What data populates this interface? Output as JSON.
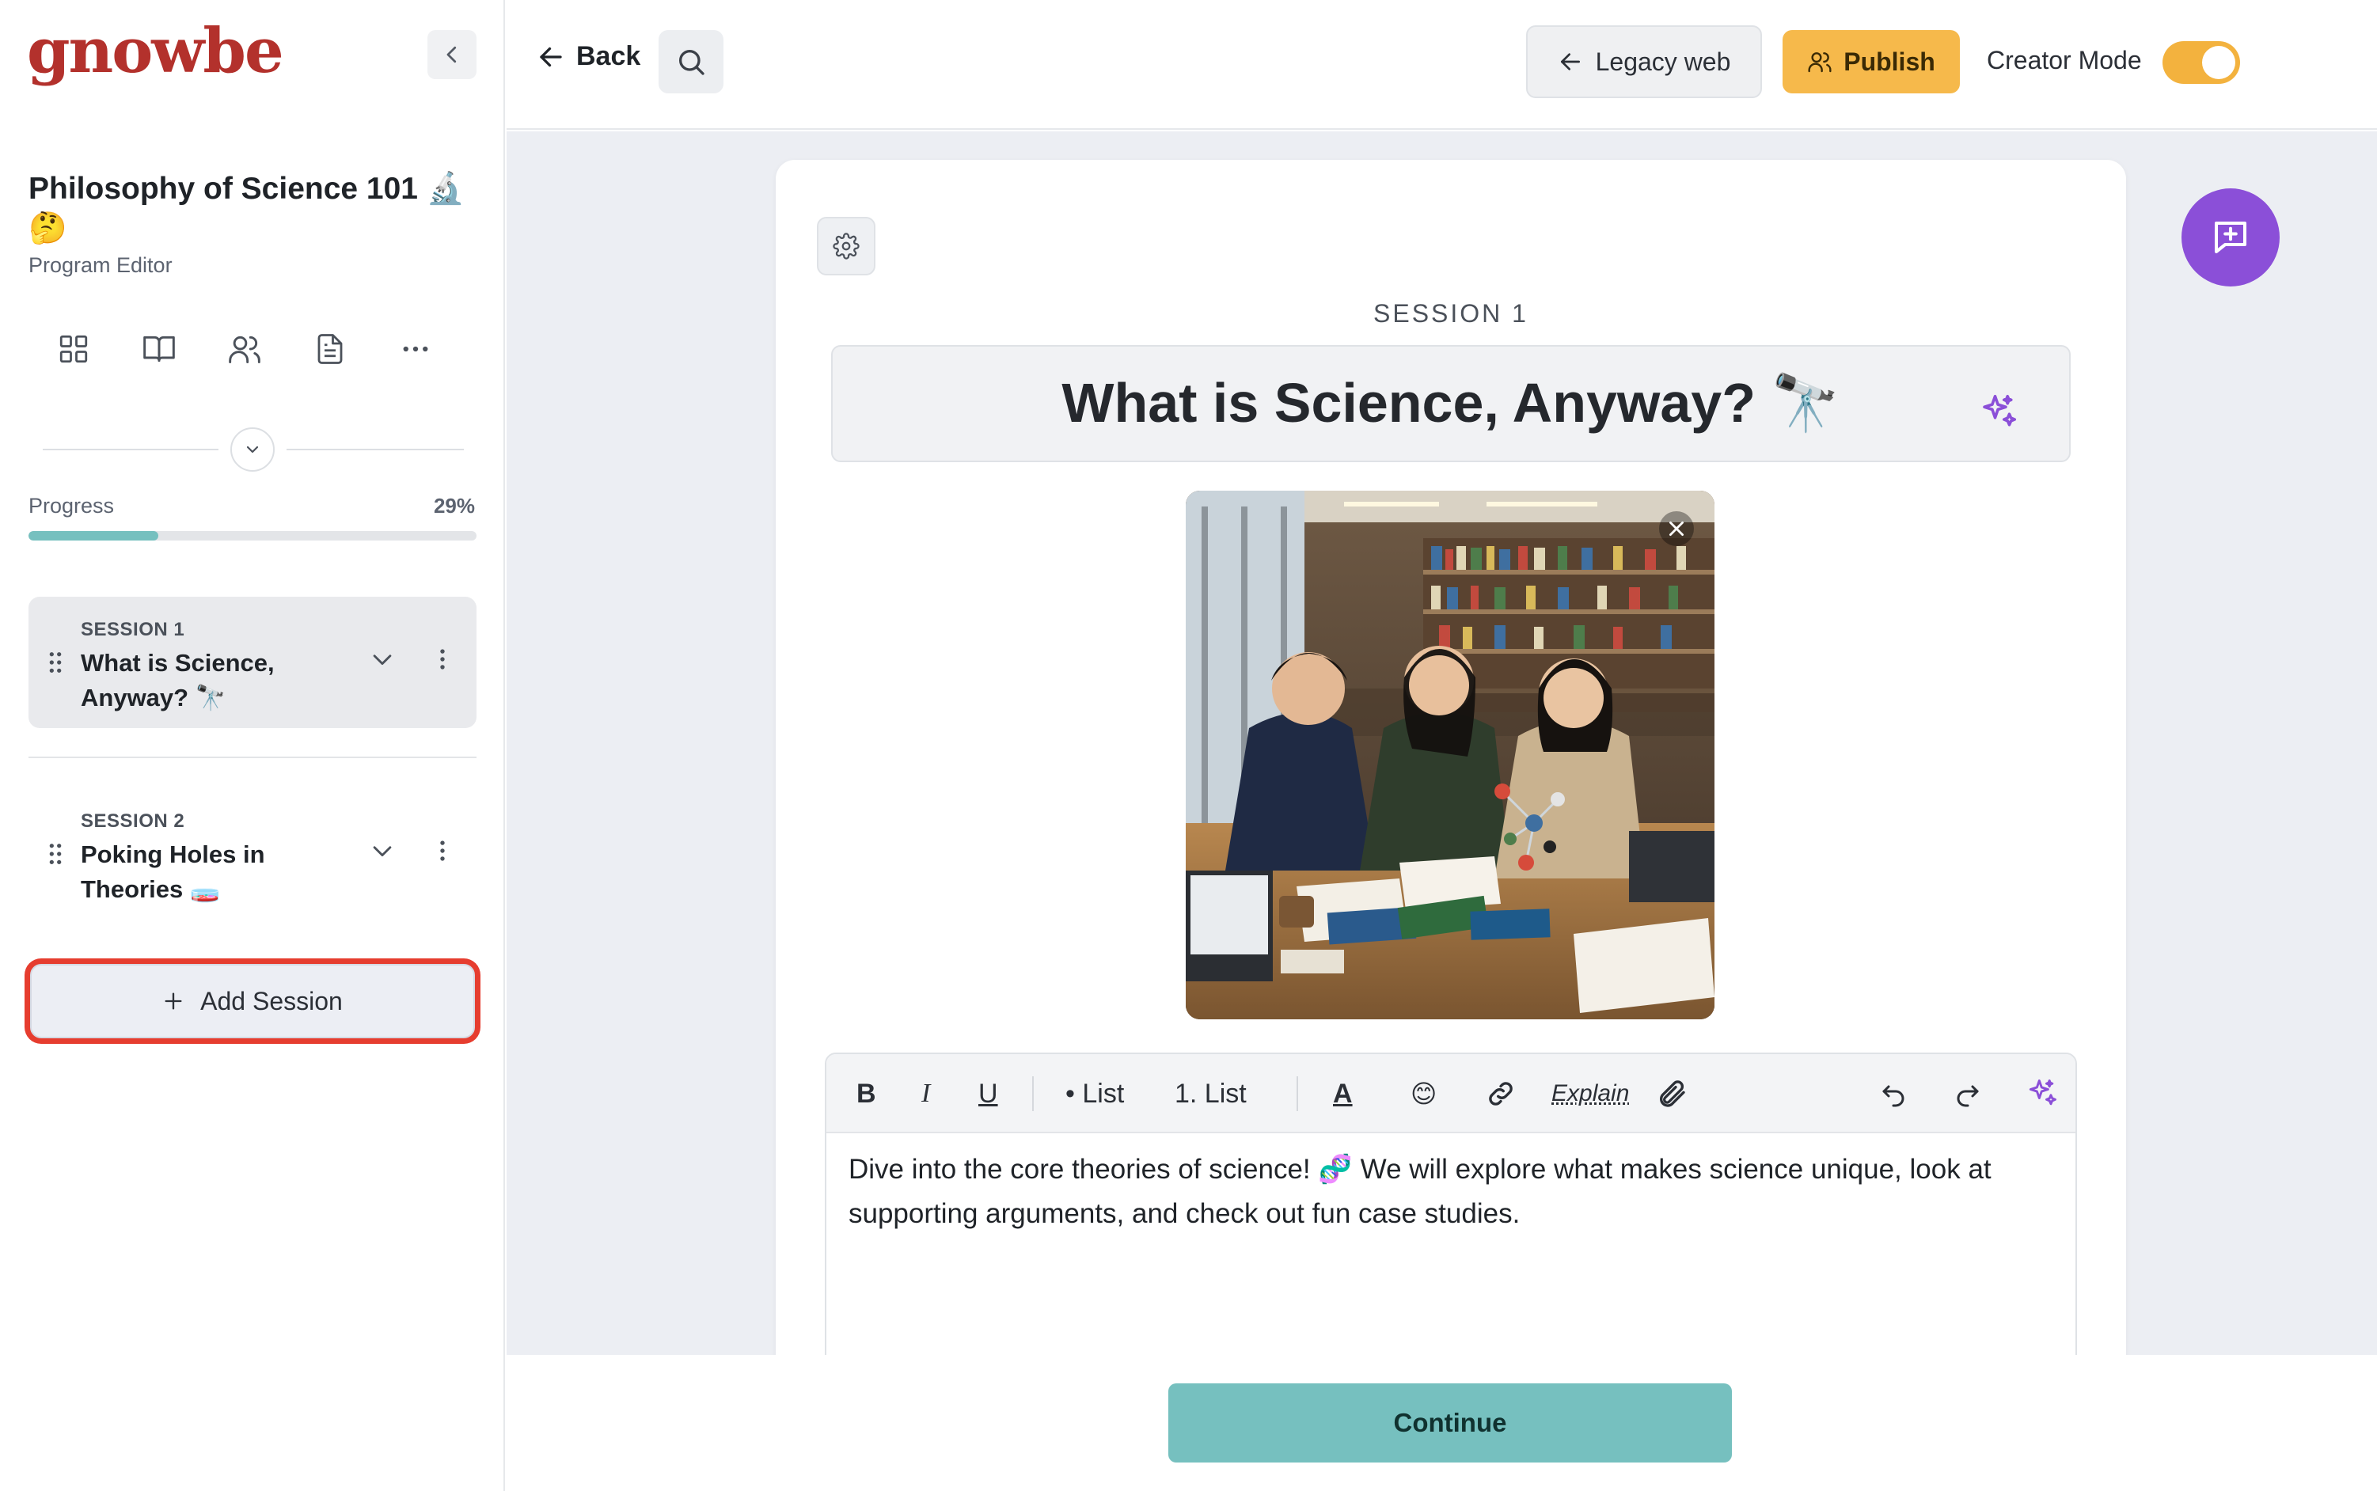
{
  "brand": {
    "logo_text": "gnowbe",
    "logo_color": "#b3312c"
  },
  "sidebar": {
    "program_title": "Philosophy of Science 101 🔬🤔",
    "program_subtitle": "Program Editor",
    "nav_icons": [
      "grid-icon",
      "book-icon",
      "users-icon",
      "document-icon",
      "more-icon"
    ],
    "progress": {
      "label": "Progress",
      "percent_text": "29%",
      "value": 0.29
    },
    "sessions": [
      {
        "label": "SESSION 1",
        "title": "What is Science, Anyway? 🔭",
        "active": true
      },
      {
        "label": "SESSION 2",
        "title": "Poking Holes in Theories 🧫",
        "active": false
      }
    ],
    "add_session_label": "Add Session"
  },
  "topbar": {
    "back_label": "Back",
    "legacy_label": "Legacy web",
    "publish_label": "Publish",
    "creator_mode_label": "Creator Mode",
    "creator_mode_on": true
  },
  "editor": {
    "session_tag": "SESSION 1",
    "session_title": "What is Science, Anyway? 🔭",
    "toolbar": {
      "bold": "B",
      "italic": "I",
      "underline": "U",
      "bullet_list": "• List",
      "numbered_list": "1. List",
      "text_color": "A",
      "emoji": "😊",
      "explain": "Explain"
    },
    "body_text": "Dive into the core theories of science! 🧬 We will explore what makes science unique, look at supporting arguments, and check out fun case studies."
  },
  "footer": {
    "continue_label": "Continue"
  },
  "colors": {
    "accent_teal": "#76c0bf",
    "publish_yellow": "#f6b94b",
    "toggle_on": "#f3b23e",
    "fab_purple": "#8b4fd8",
    "highlight_red": "#e63d2f"
  }
}
